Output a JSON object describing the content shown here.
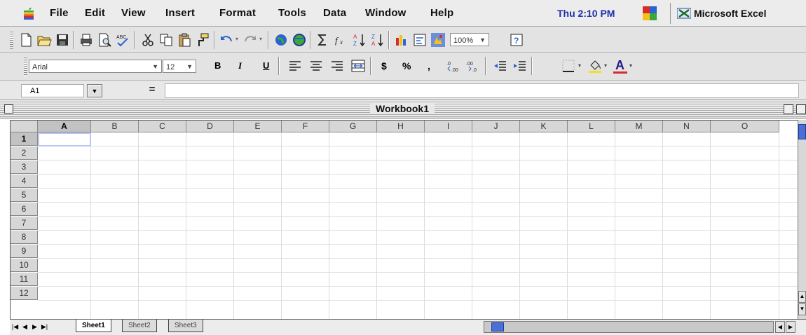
{
  "menubar": {
    "items": [
      "File",
      "Edit",
      "View",
      "Insert",
      "Format",
      "Tools",
      "Data",
      "Window",
      "Help"
    ],
    "clock": "Thu 2:10 PM",
    "app_name": "Microsoft Excel"
  },
  "toolbar_standard": {
    "zoom": "100%"
  },
  "toolbar_formatting": {
    "font": "Arial",
    "size": "12",
    "bold": "B",
    "italic": "I",
    "underline": "U",
    "currency": "$",
    "percent": "%",
    "comma": ",",
    "font_color_letter": "A"
  },
  "formula_bar": {
    "name_box": "A1",
    "equals": "=",
    "content": ""
  },
  "workbook": {
    "title": "Workbook1",
    "columns": [
      "A",
      "B",
      "C",
      "D",
      "E",
      "F",
      "G",
      "H",
      "I",
      "J",
      "K",
      "L",
      "M",
      "N",
      "O"
    ],
    "rows": [
      "1",
      "2",
      "3",
      "4",
      "5",
      "6",
      "7",
      "8",
      "9",
      "10",
      "11",
      "12"
    ],
    "active_cell": "A1"
  },
  "sheets": [
    "Sheet1",
    "Sheet2",
    "Sheet3"
  ],
  "active_sheet": "Sheet1",
  "colors": {
    "clock": "#1f2fa8",
    "scroll_thumb": "#4a6fd6",
    "selection": "#b9c6f0",
    "header": "#d7d7d7",
    "chrome": "#e3e3e3"
  }
}
